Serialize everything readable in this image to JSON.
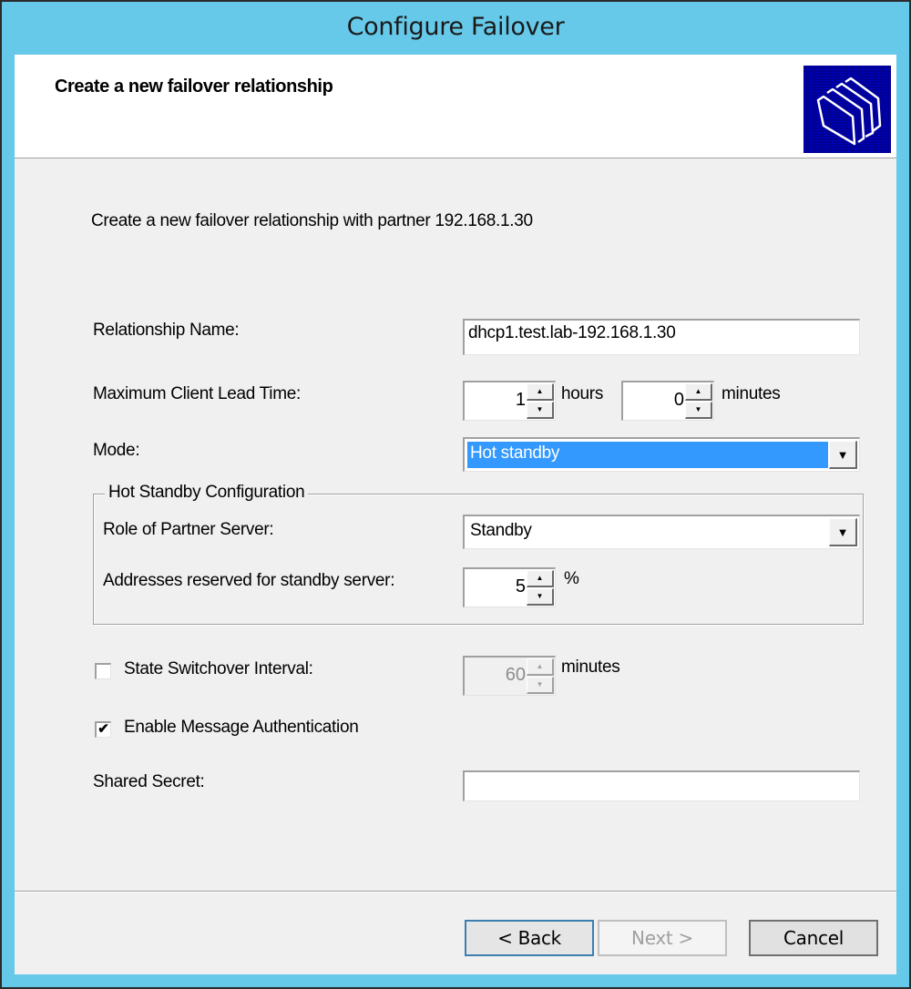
{
  "window": {
    "title": "Configure Failover"
  },
  "header": {
    "title": "Create a new failover relationship",
    "icon": "folders-icon"
  },
  "description": "Create a new failover relationship with partner 192.168.1.30",
  "form": {
    "relationship_name": {
      "label": "Relationship Name:",
      "value": "dhcp1.test.lab-192.168.1.30"
    },
    "max_client_lead_time": {
      "label": "Maximum Client Lead Time:",
      "hours": "1",
      "hours_unit": "hours",
      "minutes": "0",
      "minutes_unit": "minutes"
    },
    "mode": {
      "label": "Mode:",
      "selected": "Hot standby"
    },
    "hot_standby": {
      "group_label": "Hot Standby Configuration",
      "role_label": "Role of Partner Server:",
      "role_selected": "Standby",
      "reserved_label": "Addresses reserved for standby server:",
      "reserved_value": "5",
      "reserved_unit": "%"
    },
    "state_switchover": {
      "label": "State Switchover Interval:",
      "checked": false,
      "value": "60",
      "unit": "minutes"
    },
    "message_auth": {
      "label": "Enable Message Authentication",
      "checked": true,
      "check_glyph": "✔"
    },
    "shared_secret": {
      "label": "Shared Secret:",
      "value": ""
    }
  },
  "spin_glyphs": {
    "up": "▲",
    "down": "▼"
  },
  "combo_glyph": "▼",
  "buttons": {
    "back": "< Back",
    "next": "Next >",
    "cancel": "Cancel"
  }
}
